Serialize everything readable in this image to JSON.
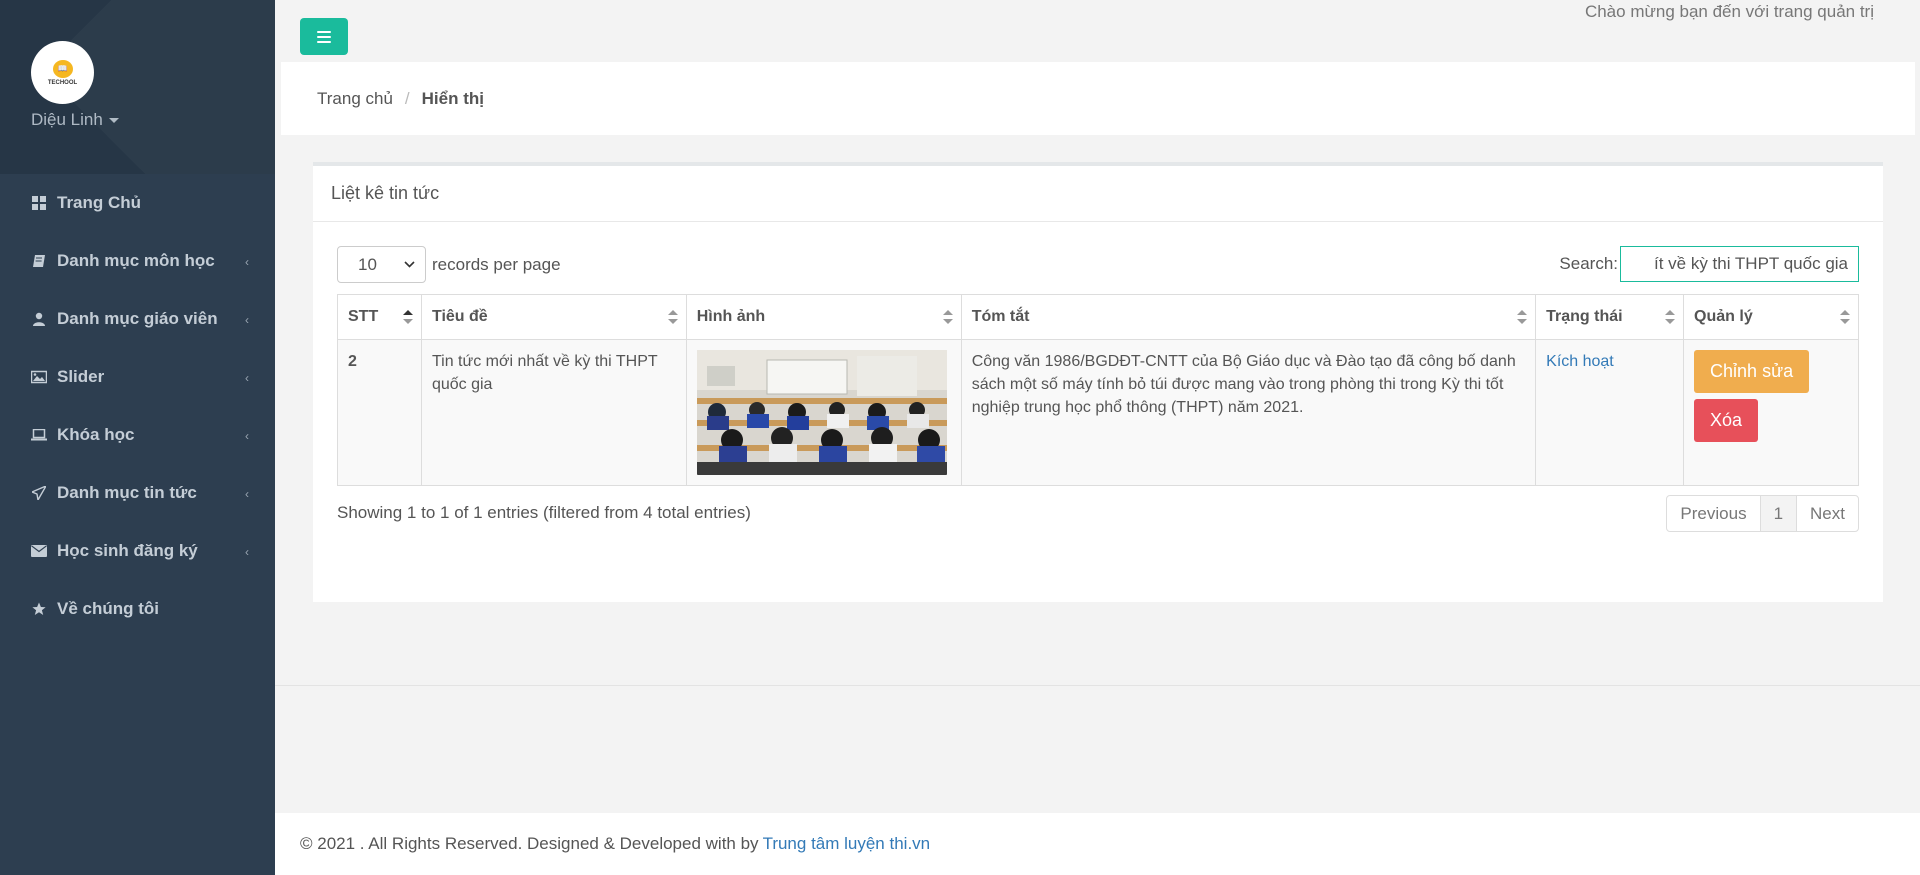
{
  "sidebar": {
    "logo_text": "TECHOOL",
    "user_name": "Diệu Linh",
    "items": [
      {
        "label": "Trang Chủ",
        "icon": "dashboard-icon",
        "has_children": false
      },
      {
        "label": "Danh mục môn học",
        "icon": "book-icon",
        "has_children": true
      },
      {
        "label": "Danh mục giáo viên",
        "icon": "user-icon",
        "has_children": true
      },
      {
        "label": "Slider",
        "icon": "image-icon",
        "has_children": true
      },
      {
        "label": "Khóa học",
        "icon": "laptop-icon",
        "has_children": true
      },
      {
        "label": "Danh mục tin tức",
        "icon": "paper-plane-icon",
        "has_children": true
      },
      {
        "label": "Học sinh đăng ký",
        "icon": "envelope-icon",
        "has_children": true
      },
      {
        "label": "Về chúng tôi",
        "icon": "star-icon",
        "has_children": false
      }
    ]
  },
  "header": {
    "welcome": "Chào mừng bạn đến với trang quản trị"
  },
  "breadcrumb": {
    "home": "Trang chủ",
    "separator": "/",
    "current": "Hiển thị"
  },
  "panel": {
    "title": "Liệt kê tin tức",
    "length_value": "10",
    "length_label": "records per page",
    "search_label": "Search:",
    "search_value": "ít về kỳ thi THPT quốc gia",
    "columns": [
      "STT",
      "Tiêu đề",
      "Hình ảnh",
      "Tóm tắt",
      "Trạng thái",
      "Quản lý"
    ],
    "rows": [
      {
        "stt": "2",
        "title": "Tin tức mới nhất về kỳ thi THPT quốc gia",
        "image_alt": "classroom-photo",
        "summary": "Công văn 1986/BGDĐT-CNTT của Bộ Giáo dục và Đào tạo đã công bố danh sách một số máy tính bỏ túi được mang vào trong phòng thi trong Kỳ thi tốt nghiệp trung học phổ thông (THPT) năm 2021.",
        "status": "Kích hoạt",
        "edit_label": "Chỉnh sửa",
        "delete_label": "Xóa"
      }
    ],
    "info": "Showing 1 to 1 of 1 entries (filtered from 4 total entries)",
    "pagination": {
      "previous": "Previous",
      "current": "1",
      "next": "Next"
    }
  },
  "footer": {
    "text": "© 2021 . All Rights Reserved. Designed & Developed with by",
    "link": "Trung tâm luyện thi.vn"
  },
  "colors": {
    "sidebar_bg": "#2d3e50",
    "accent": "#1abb9c",
    "warning": "#f0ad4e",
    "danger": "#e7505a",
    "link": "#337ab7"
  }
}
